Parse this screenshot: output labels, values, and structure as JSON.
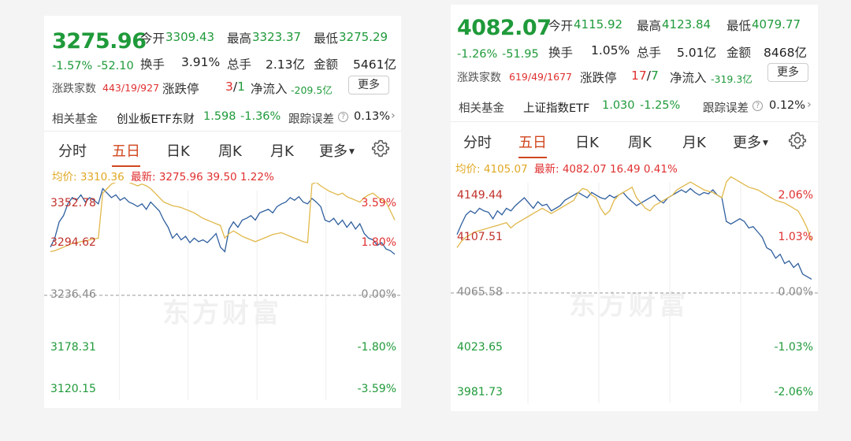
{
  "left": {
    "price": "3275.96",
    "change_pct": "-1.57%",
    "change_abs": "-52.10",
    "open_label": "今开",
    "open_value": "3309.43",
    "high_label": "最高",
    "high_value": "3323.37",
    "low_label": "最低",
    "low_value": "3275.29",
    "turnover_label": "换手",
    "turnover_value": "3.91%",
    "volume_label": "总手",
    "volume_value": "2.13亿",
    "amount_label": "金额",
    "amount_value": "5461亿",
    "breadth_label": "涨跌家数",
    "breadth_value": "443/19/927",
    "limit_label": "涨跌停",
    "limit_up": "3",
    "limit_sep": "/",
    "limit_down": "1",
    "inflow_label": "净流入",
    "inflow_value": "-209.5亿",
    "more_button": "更多",
    "fund_label": "相关基金",
    "fund_name": "创业板ETF东财",
    "fund_price": "1.598",
    "fund_change": "-1.36%",
    "track_label": "跟踪误差",
    "track_value": "0.13%",
    "tabs": [
      "分时",
      "五日",
      "日K",
      "周K",
      "月K",
      "更多"
    ],
    "avg_label": "均价:",
    "avg_value": "3310.36",
    "latest_label": "最新:",
    "latest_value": "3275.96",
    "latest_change": "39.50",
    "latest_pct": "1.22%",
    "y_left": [
      "3352.78",
      "3294.62",
      "3236.46",
      "3178.31",
      "3120.15"
    ],
    "y_right": [
      "3.59%",
      "1.80%",
      "0.00%",
      "-1.80%",
      "-3.59%"
    ],
    "watermark": "东方财富"
  },
  "right": {
    "price": "4082.07",
    "change_pct": "-1.26%",
    "change_abs": "-51.95",
    "open_label": "今开",
    "open_value": "4115.92",
    "high_label": "最高",
    "high_value": "4123.84",
    "low_label": "最低",
    "low_value": "4079.77",
    "turnover_label": "换手",
    "turnover_value": "1.05%",
    "volume_label": "总手",
    "volume_value": "5.01亿",
    "amount_label": "金额",
    "amount_value": "8468亿",
    "breadth_label": "涨跌家数",
    "breadth_value": "619/49/1677",
    "limit_label": "涨跌停",
    "limit_up": "17",
    "limit_sep": "/",
    "limit_down": "7",
    "inflow_label": "净流入",
    "inflow_value": "-319.3亿",
    "more_button": "更多",
    "fund_label": "相关基金",
    "fund_name": "上证指数ETF",
    "fund_price": "1.030",
    "fund_change": "-1.25%",
    "track_label": "跟踪误差",
    "track_value": "0.12%",
    "tabs": [
      "分时",
      "五日",
      "日K",
      "周K",
      "月K",
      "更多"
    ],
    "avg_label": "均价:",
    "avg_value": "4105.07",
    "latest_label": "最新:",
    "latest_value": "4082.07",
    "latest_change": "16.49",
    "latest_pct": "0.41%",
    "y_left": [
      "4149.44",
      "4107.51",
      "4065.58",
      "4023.65",
      "3981.73"
    ],
    "y_right": [
      "2.06%",
      "1.03%",
      "0.00%",
      "-1.03%",
      "-2.06%"
    ],
    "watermark": "东方财富"
  },
  "colors": {
    "up": "#e03030",
    "down": "#1f9a3a",
    "price_line": "#2f5f9e",
    "avg_line": "#e0b84a",
    "active_tab": "#d0461e"
  },
  "icons": [
    "question-icon",
    "chevron-right-icon",
    "gear-icon",
    "dropdown-triangle-icon"
  ],
  "chart_data": [
    {
      "type": "line",
      "title": "",
      "x": [
        0,
        1,
        2,
        3,
        4,
        5,
        6,
        7,
        8,
        9,
        10,
        11,
        12,
        13,
        14,
        15,
        16,
        17,
        18,
        19,
        20,
        21,
        22,
        23,
        24,
        25,
        26,
        27,
        28,
        29,
        30,
        31,
        32,
        33,
        34,
        35,
        36,
        37,
        38,
        39,
        40,
        41,
        42,
        43,
        44,
        45,
        46,
        47,
        48,
        49,
        50,
        51,
        52,
        53,
        54,
        55,
        56,
        57,
        58,
        59,
        60,
        61,
        62,
        63,
        64,
        65,
        66,
        67,
        68,
        69,
        70,
        71,
        72,
        73,
        74,
        75,
        76,
        77,
        78,
        79
      ],
      "ylim": [
        3120.15,
        3352.78
      ],
      "series": [
        {
          "name": "最新",
          "values": [
            3290,
            3300,
            3318,
            3325,
            3338,
            3345,
            3342,
            3348,
            3340,
            3345,
            3342,
            3338,
            3355,
            3350,
            3345,
            3348,
            3342,
            3345,
            3340,
            3338,
            3335,
            3338,
            3332,
            3340,
            3335,
            3330,
            3320,
            3312,
            3300,
            3305,
            3298,
            3302,
            3295,
            3300,
            3296,
            3298,
            3295,
            3300,
            3305,
            3290,
            3285,
            3310,
            3318,
            3312,
            3320,
            3322,
            3325,
            3320,
            3328,
            3330,
            3332,
            3328,
            3335,
            3338,
            3340,
            3345,
            3342,
            3346,
            3340,
            3338,
            3344,
            3340,
            3335,
            3320,
            3318,
            3322,
            3315,
            3320,
            3312,
            3318,
            3310,
            3316,
            3305,
            3300,
            3298,
            3292,
            3295,
            3288,
            3286,
            3282
          ]
        },
        {
          "name": "均价",
          "values": [
            3285,
            3286,
            3288,
            3290,
            3292,
            3294,
            3295,
            3296,
            3297,
            3298,
            3299,
            3300,
            3350,
            3355,
            3360,
            3362,
            3364,
            3365,
            3362,
            3360,
            3358,
            3360,
            3358,
            3355,
            3350,
            3345,
            3340,
            3338,
            3336,
            3335,
            3334,
            3332,
            3330,
            3328,
            3325,
            3322,
            3320,
            3318,
            3316,
            3314,
            3300,
            3305,
            3308,
            3305,
            3302,
            3300,
            3298,
            3296,
            3298,
            3300,
            3302,
            3304,
            3305,
            3306,
            3304,
            3302,
            3300,
            3298,
            3296,
            3295,
            3360,
            3362,
            3358,
            3355,
            3352,
            3350,
            3348,
            3350,
            3346,
            3344,
            3342,
            3340,
            3345,
            3348,
            3350,
            3346,
            3342,
            3340,
            3330,
            3320
          ]
        }
      ]
    },
    {
      "type": "line",
      "title": "",
      "x": [
        0,
        1,
        2,
        3,
        4,
        5,
        6,
        7,
        8,
        9,
        10,
        11,
        12,
        13,
        14,
        15,
        16,
        17,
        18,
        19,
        20,
        21,
        22,
        23,
        24,
        25,
        26,
        27,
        28,
        29,
        30,
        31,
        32,
        33,
        34,
        35,
        36,
        37,
        38,
        39,
        40,
        41,
        42,
        43,
        44,
        45,
        46,
        47,
        48,
        49,
        50,
        51,
        52,
        53,
        54,
        55,
        56,
        57,
        58,
        59,
        60,
        61,
        62,
        63,
        64,
        65,
        66,
        67,
        68,
        69,
        70,
        71,
        72,
        73,
        74,
        75,
        76,
        77,
        78,
        79
      ],
      "ylim": [
        3981.73,
        4149.44
      ],
      "series": [
        {
          "name": "最新",
          "values": [
            4110,
            4118,
            4125,
            4128,
            4126,
            4130,
            4128,
            4127,
            4122,
            4128,
            4125,
            4130,
            4128,
            4132,
            4135,
            4138,
            4134,
            4130,
            4135,
            4132,
            4133,
            4128,
            4130,
            4132,
            4136,
            4138,
            4140,
            4142,
            4140,
            4138,
            4142,
            4140,
            4138,
            4137,
            4140,
            4138,
            4140,
            4142,
            4138,
            4135,
            4132,
            4134,
            4136,
            4138,
            4140,
            4136,
            4134,
            4138,
            4140,
            4142,
            4144,
            4142,
            4145,
            4142,
            4140,
            4142,
            4141,
            4144,
            4140,
            4138,
            4120,
            4118,
            4120,
            4122,
            4120,
            4115,
            4116,
            4112,
            4108,
            4100,
            4098,
            4092,
            4095,
            4088,
            4090,
            4085,
            4088,
            4080,
            4078,
            4076
          ]
        },
        {
          "name": "均价",
          "values": [
            4100,
            4105,
            4108,
            4110,
            4112,
            4113,
            4114,
            4115,
            4116,
            4117,
            4118,
            4119,
            4115,
            4118,
            4120,
            4122,
            4124,
            4126,
            4128,
            4130,
            4128,
            4126,
            4128,
            4130,
            4132,
            4134,
            4136,
            4142,
            4145,
            4144,
            4140,
            4138,
            4130,
            4125,
            4128,
            4136,
            4140,
            4142,
            4144,
            4146,
            4138,
            4134,
            4130,
            4128,
            4132,
            4134,
            4136,
            4138,
            4140,
            4144,
            4146,
            4148,
            4150,
            4148,
            4146,
            4144,
            4143,
            4142,
            4140,
            4138,
            4150,
            4154,
            4152,
            4150,
            4148,
            4146,
            4145,
            4144,
            4142,
            4140,
            4138,
            4136,
            4135,
            4134,
            4132,
            4130,
            4128,
            4122,
            4115,
            4105
          ]
        }
      ]
    }
  ]
}
